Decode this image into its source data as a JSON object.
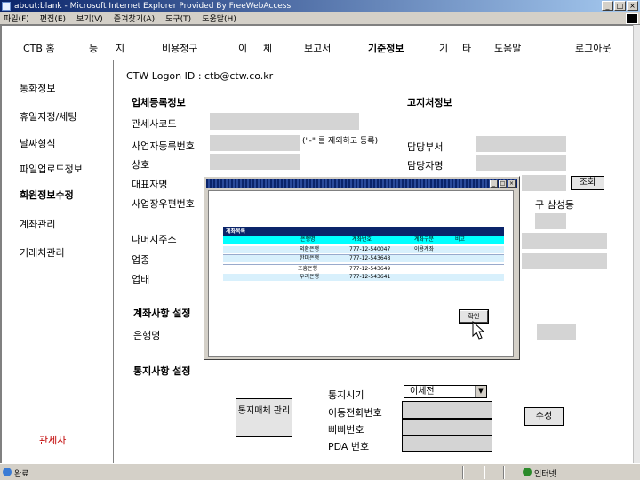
{
  "window": {
    "title": "about:blank - Microsoft Internet Explorer Provided By FreeWebAccess",
    "buttons": [
      "_",
      "□",
      "×"
    ]
  },
  "menubar": [
    "파일(F)",
    "편집(E)",
    "보기(V)",
    "즐겨찾기(A)",
    "도구(T)",
    "도움말(H)"
  ],
  "topnav": {
    "home": "CTB 홈",
    "items": [
      "등",
      "지",
      "비용청구",
      "이",
      "체",
      "보고서"
    ],
    "active": "기준정보",
    "items2": [
      "기",
      "타",
      "도움말"
    ],
    "logout": "로그아웃"
  },
  "sidebar": {
    "items": [
      "통화정보",
      "휴일지정/세팅",
      "날짜형식",
      "파일업로드정보"
    ],
    "active": "회원정보수정",
    "items2": [
      "계좌관리",
      "거래처관리"
    ],
    "footer": "관세사"
  },
  "form": {
    "logon": "CTW Logon ID : ctb@ctw.co.kr",
    "company_header": "업체등록정보",
    "notify_header": "고지처정보",
    "customs_code": "관세사코드",
    "biz_reg_no": "사업자등록번호",
    "biz_note": "(\"-\" 를 제외하고 등록)",
    "company_name": "상호",
    "dept": "담당부서",
    "contact": "담당자명",
    "ceo": "대표자명",
    "biz_zip": "사업장우편번호",
    "dist_text": "구 삼성동",
    "address": "나머지주소",
    "industry": "업종",
    "business": "업태",
    "lookup_btn": "조회",
    "account_header": "계좌사항 설정",
    "bank": "은행명",
    "notice_header": "통지사항 설정",
    "notice_media_btn": "통지매체 관리",
    "notice_time": "통지시기",
    "notice_time_value": "이체전",
    "mobile": "이동전화번호",
    "pager": "삐삐번호",
    "pda": "PDA 번호",
    "edit_btn": "수정"
  },
  "popup": {
    "title_buttons": [
      "_",
      "□",
      "×"
    ],
    "table_title": "계좌목록",
    "columns": [
      "은행명",
      "계좌번호",
      "계좌구분",
      "비고"
    ],
    "rows": [
      [
        "외환은행",
        "777-12-540047",
        "이용계좌",
        ""
      ],
      [
        "한미은행",
        "777-12-543648",
        "",
        ""
      ],
      [
        "조흥은행",
        "777-12-543649",
        "",
        ""
      ],
      [
        "우리은행",
        "777-12-543641",
        "",
        ""
      ]
    ],
    "confirm": "확인"
  },
  "status": {
    "left": "완료",
    "zone": "인터넷"
  }
}
